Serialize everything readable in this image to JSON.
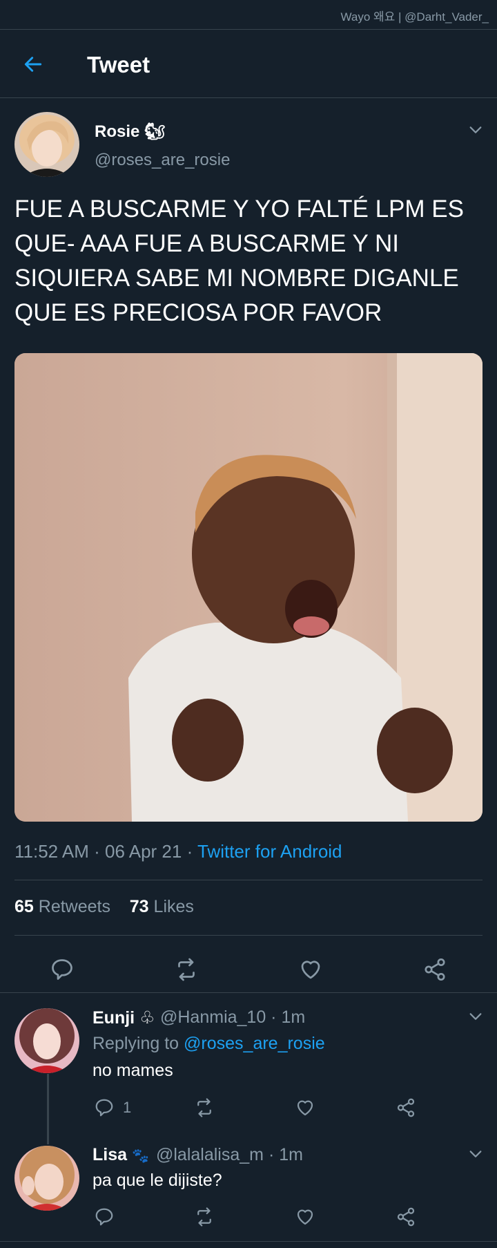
{
  "watermark": "Wayo 왜요 | @Darht_Vader_",
  "header": {
    "title": "Tweet"
  },
  "tweet": {
    "author_name": "Rosie",
    "author_emoji": "🐿",
    "author_handle": "@roses_are_rosie",
    "text": "FUE A BUSCARME Y YO FALTÉ LPM ES QUE- AAA FUE A BUSCARME Y NI SIQUIERA SABE MI NOMBRE DIGANLE QUE ES PRECIOSA POR FAVOR",
    "time": "11:52 AM · 06 Apr 21 · ",
    "source": "Twitter for Android",
    "retweets_count": "65",
    "retweets_label": "Retweets",
    "likes_count": "73",
    "likes_label": "Likes"
  },
  "replies": [
    {
      "name": "Eunji",
      "emoji": "♧",
      "meta": "@Hanmia_10 · 1m",
      "replying_label": "Replying to ",
      "replying_handle": "@roses_are_rosie",
      "text": "no mames",
      "reply_count": "1"
    },
    {
      "name": "Lisa",
      "emoji": "🐾",
      "meta": "@lalalalisa_m · 1m",
      "text": "pa que le dijiste?"
    }
  ],
  "colors": {
    "background": "#15202b",
    "accent": "#1da1f2",
    "muted": "#8899a6",
    "divider": "#38444d"
  }
}
